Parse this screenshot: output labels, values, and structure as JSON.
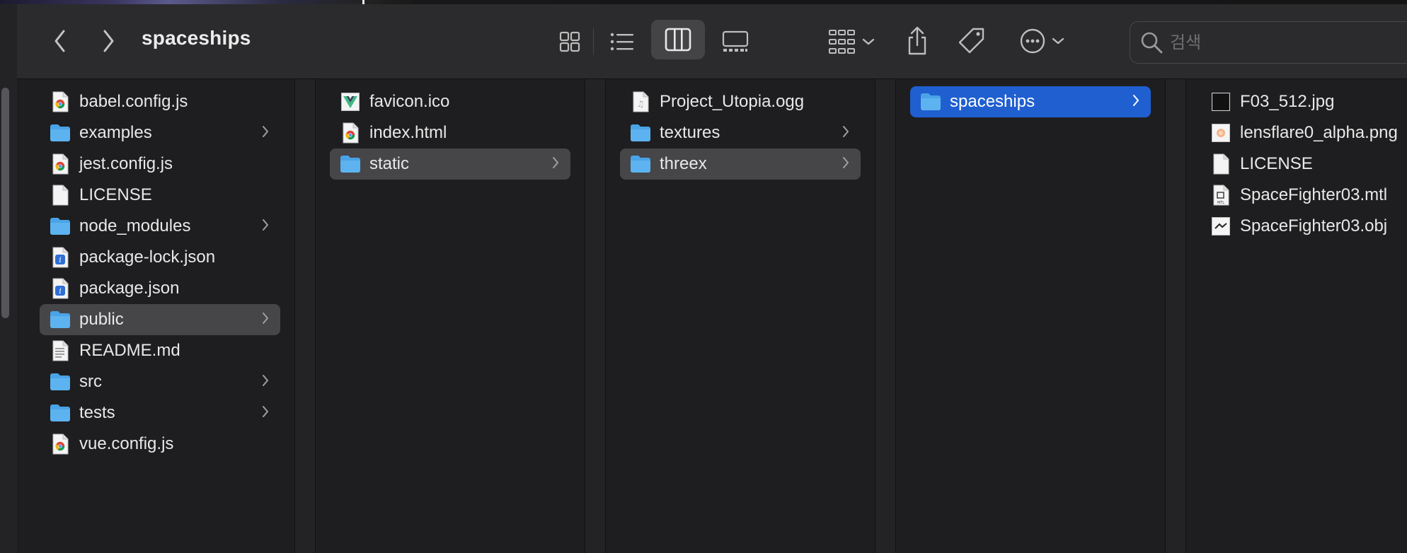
{
  "window": {
    "title": "spaceships"
  },
  "toolbar": {
    "back_icon": "chevron-left-icon",
    "forward_icon": "chevron-right-icon",
    "views": [
      "icon-view-icon",
      "list-view-icon",
      "column-view-icon",
      "gallery-view-icon"
    ],
    "active_view": "column",
    "group_icon": "group-grid-icon",
    "share_icon": "share-icon",
    "tag_icon": "tag-icon",
    "more_icon": "more-ellipsis-icon"
  },
  "search": {
    "placeholder": "검색",
    "value": ""
  },
  "columns": [
    {
      "items": [
        {
          "name": "babel.config.js",
          "kind": "chrome-doc",
          "folder": false
        },
        {
          "name": "examples",
          "kind": "folder",
          "folder": true
        },
        {
          "name": "jest.config.js",
          "kind": "chrome-doc",
          "folder": false
        },
        {
          "name": "LICENSE",
          "kind": "blank-doc",
          "folder": false
        },
        {
          "name": "node_modules",
          "kind": "folder",
          "folder": true
        },
        {
          "name": "package-lock.json",
          "kind": "json-doc",
          "folder": false
        },
        {
          "name": "package.json",
          "kind": "json-doc",
          "folder": false
        },
        {
          "name": "public",
          "kind": "folder",
          "folder": true,
          "selected": "gray"
        },
        {
          "name": "README.md",
          "kind": "text-doc",
          "folder": false
        },
        {
          "name": "src",
          "kind": "folder",
          "folder": true
        },
        {
          "name": "tests",
          "kind": "folder",
          "folder": true
        },
        {
          "name": "vue.config.js",
          "kind": "chrome-doc",
          "folder": false
        }
      ]
    },
    {
      "items": [
        {
          "name": "favicon.ico",
          "kind": "vue-doc",
          "folder": false
        },
        {
          "name": "index.html",
          "kind": "chrome-doc",
          "folder": false
        },
        {
          "name": "static",
          "kind": "folder",
          "folder": true,
          "selected": "gray"
        }
      ]
    },
    {
      "items": [
        {
          "name": "Project_Utopia.ogg",
          "kind": "audio-doc",
          "folder": false
        },
        {
          "name": "textures",
          "kind": "folder",
          "folder": true
        },
        {
          "name": "threex",
          "kind": "folder",
          "folder": true,
          "selected": "gray"
        }
      ]
    },
    {
      "items": [
        {
          "name": "spaceships",
          "kind": "folder",
          "folder": true,
          "selected": "blue"
        }
      ]
    },
    {
      "items": [
        {
          "name": "F03_512.jpg",
          "kind": "image-doc",
          "folder": false
        },
        {
          "name": "lensflare0_alpha.png",
          "kind": "png-doc",
          "folder": false
        },
        {
          "name": "LICENSE",
          "kind": "blank-doc",
          "folder": false
        },
        {
          "name": "SpaceFighter03.mtl",
          "kind": "mtl-doc",
          "folder": false
        },
        {
          "name": "SpaceFighter03.obj",
          "kind": "obj-doc",
          "folder": false
        }
      ]
    }
  ],
  "colors": {
    "selection_blue": "#1f5fd0",
    "selection_gray": "#464649",
    "folder_blue": "#4aa3e6"
  }
}
